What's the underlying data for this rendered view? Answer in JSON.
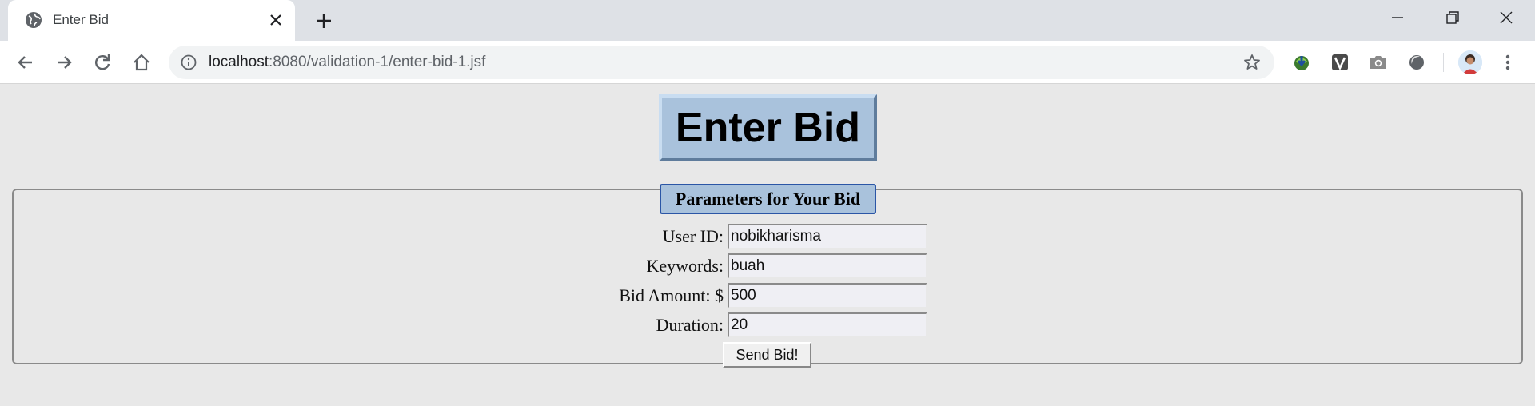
{
  "browser": {
    "tab_title": "Enter Bid",
    "url_host": "localhost",
    "url_path": ":8080/validation-1/enter-bid-1.jsf",
    "icons": {
      "favicon": "globe-icon",
      "tab_close": "close-icon",
      "new_tab": "plus-icon",
      "back": "arrow-left-icon",
      "forward": "arrow-right-icon",
      "reload": "reload-icon",
      "home": "home-icon",
      "site_info": "info-icon",
      "bookmark": "star-icon",
      "menu": "kebab-menu-icon"
    }
  },
  "page": {
    "title": "Enter Bid",
    "legend": "Parameters for Your Bid",
    "fields": [
      {
        "label": "User ID:",
        "value": "nobikharisma"
      },
      {
        "label": "Keywords:",
        "value": "buah"
      },
      {
        "label": "Bid Amount: $",
        "value": "500"
      },
      {
        "label": "Duration:",
        "value": "20"
      }
    ],
    "submit_label": "Send Bid!"
  },
  "colors": {
    "page_bg": "#e8e8e8",
    "title_bg": "#a9c2dc",
    "legend_border": "#2b56a6"
  }
}
